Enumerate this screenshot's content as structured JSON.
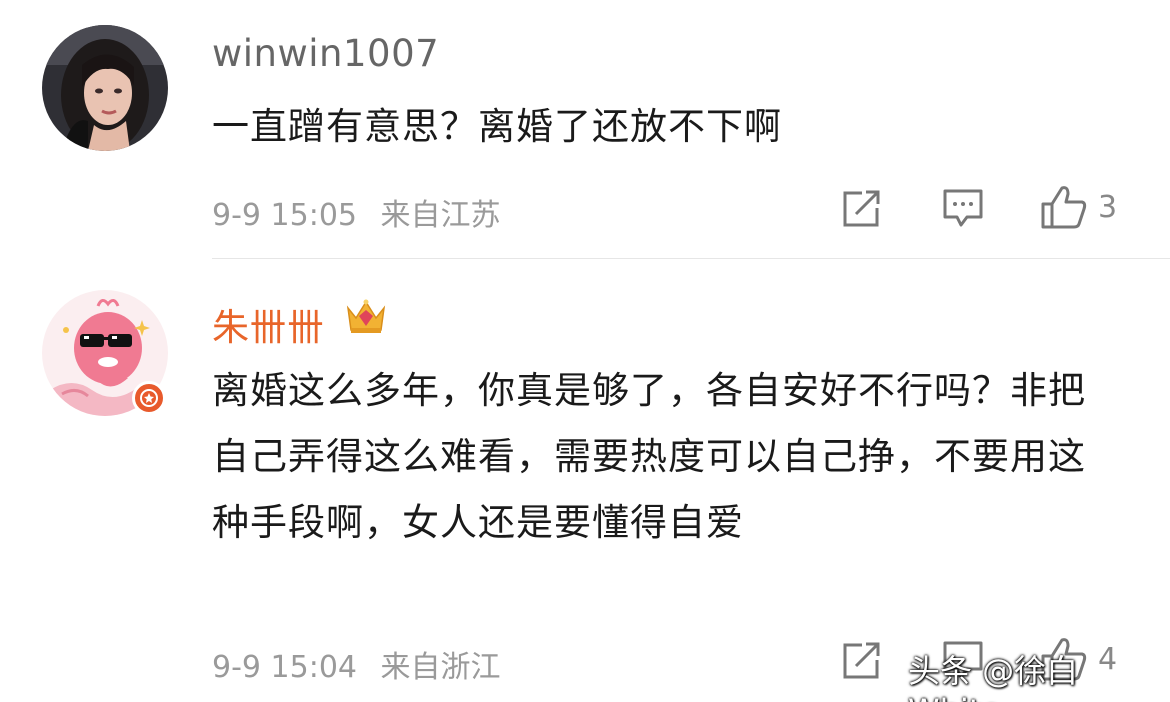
{
  "comments": [
    {
      "username": "winwin1007",
      "text": "一直蹭有意思？离婚了还放不下啊",
      "time": "9-9 15:05",
      "location": "来自江苏",
      "likes": "3"
    },
    {
      "username": "朱卌卌",
      "text": "离婚这么多年，你真是够了，各自安好不行吗？非把自己弄得这么难看，需要热度可以自己挣，不要用这种手段啊，女人还是要懂得自爱",
      "time": "9-9 15:04",
      "location": "来自浙江",
      "likes": "4"
    }
  ],
  "watermark": "头条 @徐白White"
}
